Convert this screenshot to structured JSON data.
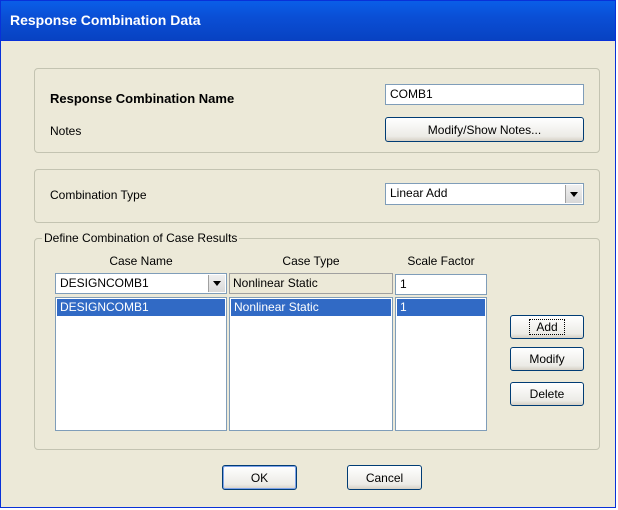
{
  "window": {
    "title": "Response Combination Data"
  },
  "name_section": {
    "name_label": "Response Combination Name",
    "name_value": "COMB1",
    "notes_label": "Notes",
    "notes_button": "Modify/Show Notes..."
  },
  "type_section": {
    "label": "Combination Type",
    "selected": "Linear Add"
  },
  "cases_section": {
    "legend": "Define Combination of Case Results",
    "headers": {
      "case_name": "Case Name",
      "case_type": "Case Type",
      "scale_factor": "Scale Factor"
    },
    "editor": {
      "case_name": "DESIGNCOMB1",
      "case_type": "Nonlinear Static",
      "scale_factor": "1"
    },
    "rows": [
      {
        "case_name": "DESIGNCOMB1",
        "case_type": "Nonlinear Static",
        "scale_factor": "1"
      }
    ],
    "buttons": {
      "add": "Add",
      "modify": "Modify",
      "delete": "Delete"
    }
  },
  "footer": {
    "ok": "OK",
    "cancel": "Cancel"
  }
}
